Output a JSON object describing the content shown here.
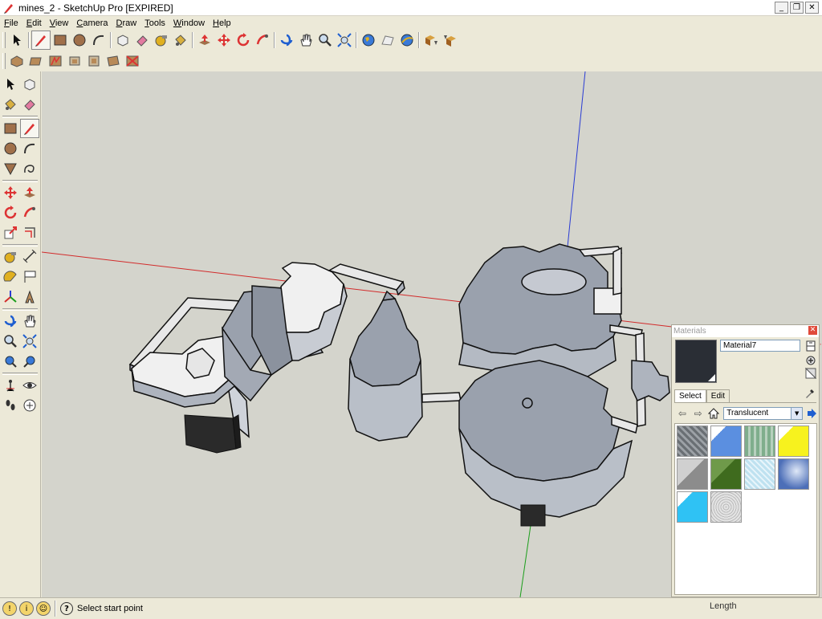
{
  "window": {
    "title": "mines_2 - SketchUp Pro [EXPIRED]",
    "minimize": "_",
    "restore": "❐",
    "close": "✕"
  },
  "menu": [
    {
      "label": "File"
    },
    {
      "label": "Edit"
    },
    {
      "label": "View"
    },
    {
      "label": "Camera"
    },
    {
      "label": "Draw"
    },
    {
      "label": "Tools"
    },
    {
      "label": "Window"
    },
    {
      "label": "Help"
    }
  ],
  "materials_panel": {
    "title": "Materials",
    "close": "✕",
    "material_name": "Material7",
    "tabs": [
      "Select",
      "Edit"
    ],
    "collection": "Translucent",
    "swatch_color": "#2a2e35",
    "swatches": [
      {
        "name": "translucent-glass-grid",
        "color": "#7a7f84"
      },
      {
        "name": "translucent-blue",
        "color": "#5b8fe0"
      },
      {
        "name": "translucent-green-stripes",
        "color": "#8fb59a"
      },
      {
        "name": "translucent-yellow",
        "color": "#f7f21e"
      },
      {
        "name": "translucent-gray",
        "color": "#8c8c8c"
      },
      {
        "name": "translucent-dark-green",
        "color": "#3f6b1e"
      },
      {
        "name": "translucent-light-blue-grid",
        "color": "#bfe2f0"
      },
      {
        "name": "translucent-sky",
        "color": "#4d6fb8"
      },
      {
        "name": "translucent-cyan",
        "color": "#2fc2f4"
      },
      {
        "name": "translucent-speckle",
        "color": "#c8c8c8"
      }
    ]
  },
  "statusbar": {
    "help": "?",
    "text": "Select start point",
    "vcb_label": "Length"
  },
  "colors": {
    "viewport_bg": "#d4d4cc",
    "axis_red": "#d22b2b",
    "axis_green": "#1b9e1b",
    "axis_blue": "#2a3cd4",
    "model_top": "#9aa1ad",
    "model_white": "#f0f0f0",
    "model_dark": "#2a2a2a"
  }
}
